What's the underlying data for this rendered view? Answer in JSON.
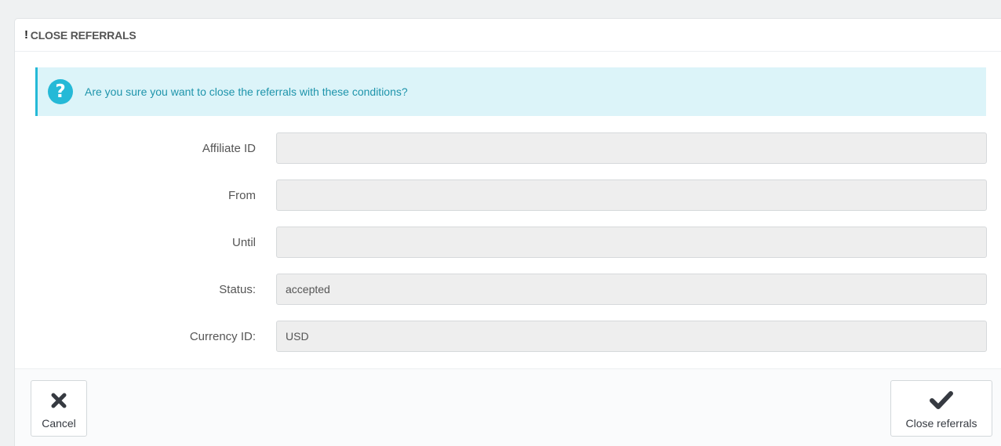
{
  "panel": {
    "title": "CLOSE REFERRALS",
    "title_icon": "!"
  },
  "alert": {
    "icon": "question-circle-icon",
    "glyph": "?",
    "text": "Are you sure you want to close the referrals with these conditions?"
  },
  "form": {
    "fields": [
      {
        "label": "Affiliate ID",
        "value": ""
      },
      {
        "label": "From",
        "value": ""
      },
      {
        "label": "Until",
        "value": ""
      },
      {
        "label": "Status:",
        "value": "accepted"
      },
      {
        "label": "Currency ID:",
        "value": "USD"
      }
    ]
  },
  "footer": {
    "cancel_label": "Cancel",
    "cancel_icon": "close-icon",
    "submit_label": "Close referrals",
    "submit_icon": "checkmark-icon"
  },
  "colors": {
    "alert_bg": "#dcf4f9",
    "alert_accent": "#25b9d7",
    "alert_text": "#1e94ab"
  }
}
